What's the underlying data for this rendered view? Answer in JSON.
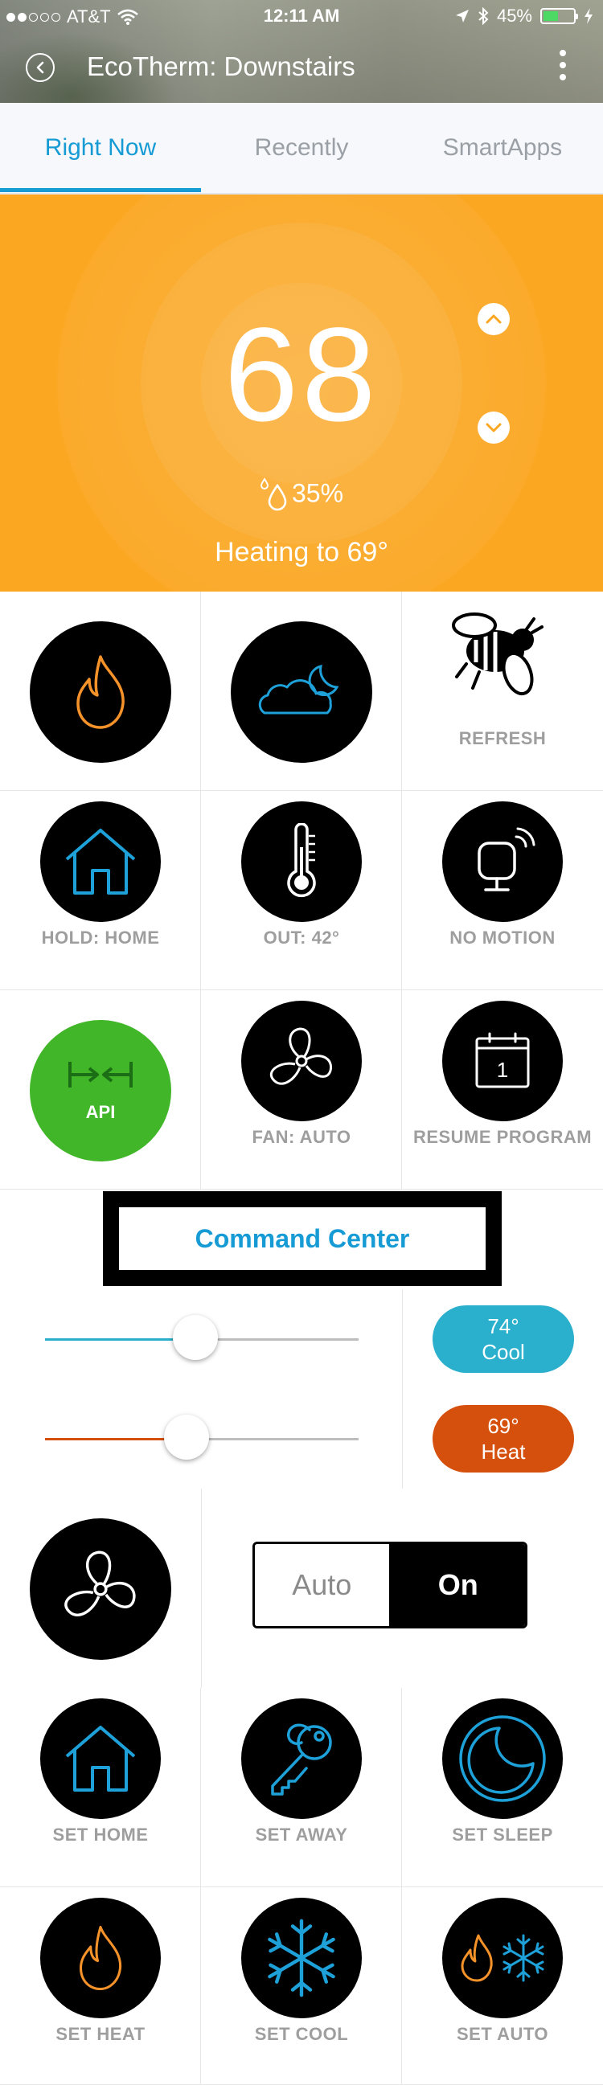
{
  "status_bar": {
    "carrier": "AT&T",
    "time": "12:11 AM",
    "battery": "45%"
  },
  "header": {
    "title": "EcoTherm: Downstairs"
  },
  "tabs": [
    {
      "label": "Right Now"
    },
    {
      "label": "Recently"
    },
    {
      "label": "SmartApps"
    }
  ],
  "thermostat": {
    "temperature": "68",
    "humidity": "35%",
    "status": "Heating to 69°",
    "background_color": "#fba722"
  },
  "tiles": {
    "refresh": "REFRESH",
    "hold": "HOLD: HOME",
    "outside": "OUT: 42°",
    "motion": "NO MOTION",
    "api": "API",
    "fan": "FAN: AUTO",
    "resume": "RESUME PROGRAM",
    "calendar_day": "1"
  },
  "command_center": {
    "label": "Command Center"
  },
  "cool_setpoint": {
    "temp": "74°",
    "mode": "Cool",
    "level": 0.48,
    "color": "#2ab0cc"
  },
  "heat_setpoint": {
    "temp": "69°",
    "mode": "Heat",
    "level": 0.45,
    "color": "#d6500d"
  },
  "fan_mode": {
    "option_auto": "Auto",
    "option_on": "On",
    "selected": "On"
  },
  "modes": {
    "set_home": "SET HOME",
    "set_away": "SET AWAY",
    "set_sleep": "SET SLEEP",
    "set_heat": "SET HEAT",
    "set_cool": "SET COOL",
    "set_auto": "SET AUTO"
  },
  "colors": {
    "accent": "#169bd5",
    "heat_icon": "#f5922a",
    "cool_icon": "#1da1d8",
    "api_green": "#40b628"
  }
}
